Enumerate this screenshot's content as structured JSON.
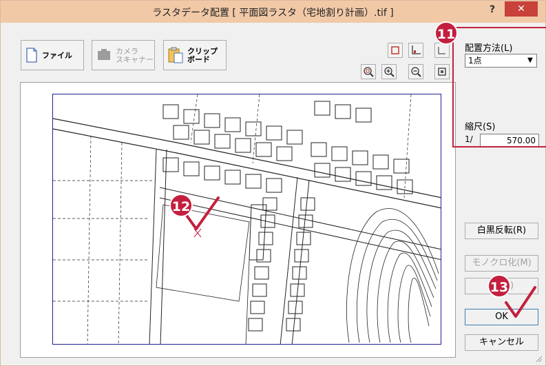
{
  "window": {
    "title": "ラスタデータ配置 [ 平面図ラスタ（宅地割り計画）.tif ]",
    "help_label": "?",
    "close_label": "✕"
  },
  "toolbar": {
    "file_label": "ファイル",
    "camera_label_line1": "カメラ",
    "camera_label_line2": "スキャナー",
    "clipboard_label_line1": "クリップ",
    "clipboard_label_line2": "ボード"
  },
  "view_tools": {
    "icons": [
      "select-rect-icon",
      "axis-icon",
      "extra-icon",
      "zoom-fit-icon",
      "zoom-in-icon",
      "zoom-out-icon",
      "zoom-all-icon"
    ]
  },
  "side_panel": {
    "placement_method_label": "配置方法(L)",
    "placement_method_value": "1点",
    "scale_label": "縮尺(S)",
    "scale_prefix": "1/",
    "scale_value": "570.00",
    "invert_button": "白黒反転(R)",
    "mono_button": "モノクロ化(M)",
    "hidden_button_tail": ")",
    "ok_button": "OK",
    "cancel_button": "キャンセル"
  },
  "callouts": {
    "c11": "11",
    "c12": "12",
    "c13": "13"
  },
  "colors": {
    "titlebar": "#f1c9a7",
    "close_button": "#c8413b",
    "callout": "#c41f3e",
    "raster_border": "#1f1f8f"
  }
}
